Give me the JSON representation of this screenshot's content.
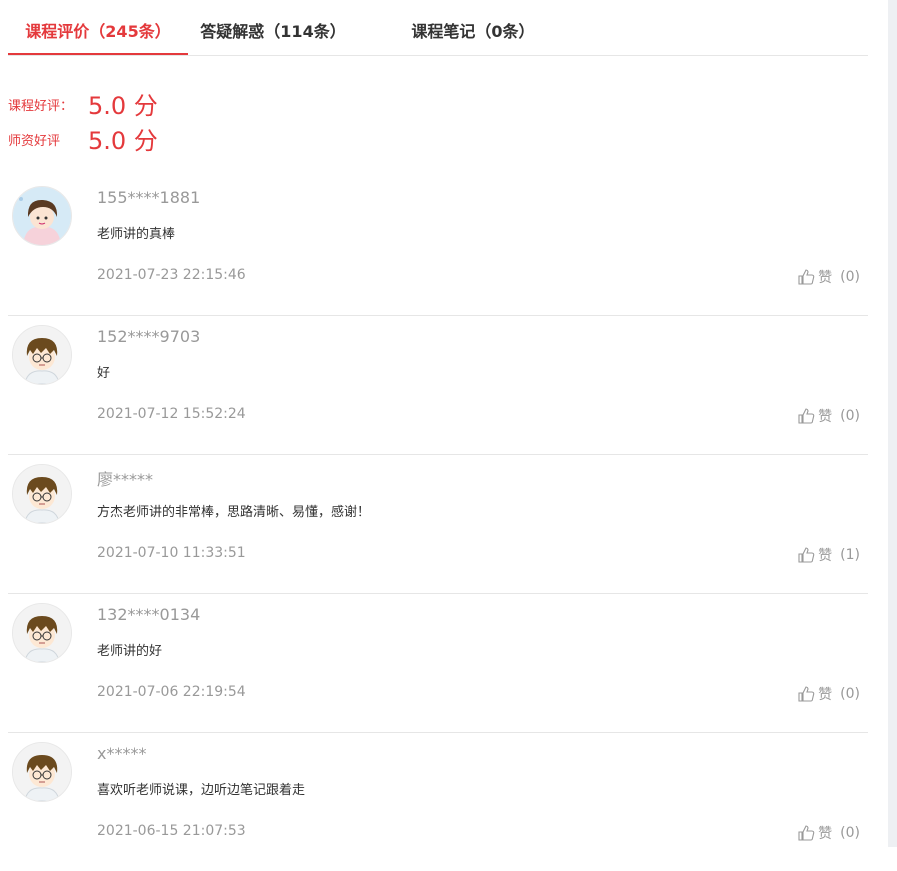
{
  "tabs": [
    {
      "label": "课程评价（245条）",
      "active": true
    },
    {
      "label": "答疑解惑（114条）",
      "active": false
    },
    {
      "label": "课程笔记（0条）",
      "active": false
    }
  ],
  "ratings": [
    {
      "label": "课程好评：",
      "score": "5.0 分"
    },
    {
      "label": "师资好评",
      "score": "5.0 分"
    }
  ],
  "reviews": [
    {
      "username": "155****1881",
      "content": "老师讲的真棒",
      "time": "2021-07-23 22:15:46",
      "like_label": "赞",
      "like_count": "(0)",
      "avatar": "girl-avatar"
    },
    {
      "username": "152****9703",
      "content": "好",
      "time": "2021-07-12 15:52:24",
      "like_label": "赞",
      "like_count": "(0)",
      "avatar": "boy-avatar"
    },
    {
      "username": "廖*****",
      "content": "方杰老师讲的非常棒，思路清晰、易懂，感谢！",
      "time": "2021-07-10 11:33:51",
      "like_label": "赞",
      "like_count": "(1)",
      "avatar": "boy-avatar"
    },
    {
      "username": "132****0134",
      "content": "老师讲的好",
      "time": "2021-07-06 22:19:54",
      "like_label": "赞",
      "like_count": "(0)",
      "avatar": "boy-avatar"
    },
    {
      "username": "x*****",
      "content": "喜欢听老师说课，边听边笔记跟着走",
      "time": "2021-06-15 21:07:53",
      "like_label": "赞",
      "like_count": "(0)",
      "avatar": "boy-avatar"
    }
  ],
  "colors": {
    "accent": "#e4393c",
    "muted": "#999999",
    "divider": "#e6e6e6"
  }
}
